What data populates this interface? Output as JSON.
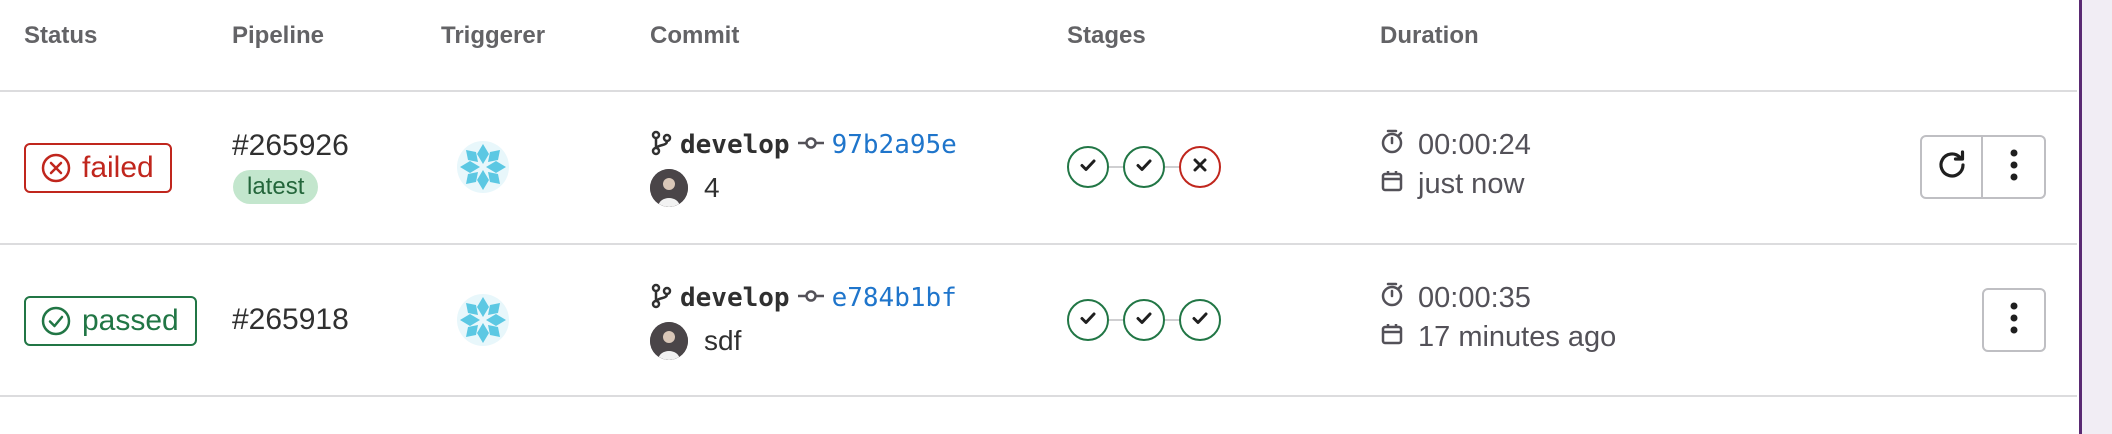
{
  "headers": {
    "status": "Status",
    "pipeline": "Pipeline",
    "triggerer": "Triggerer",
    "commit": "Commit",
    "stages": "Stages",
    "duration": "Duration"
  },
  "pipelines": [
    {
      "status": "failed",
      "id": "#265926",
      "tag": "latest",
      "branch": "develop",
      "sha": "97b2a95e",
      "message": "4",
      "stages": [
        "success",
        "success",
        "failed"
      ],
      "duration": "00:00:24",
      "finished": "just now",
      "actions": [
        "retry-icon",
        "kebab-icon"
      ]
    },
    {
      "status": "passed",
      "id": "#265918",
      "branch": "develop",
      "sha": "e784b1bf",
      "message": "sdf",
      "stages": [
        "success",
        "success",
        "success"
      ],
      "duration": "00:00:35",
      "finished": "17 minutes ago",
      "actions": [
        "kebab-icon"
      ]
    }
  ],
  "colors": {
    "failed": "#c0261d",
    "passed": "#217645",
    "link": "#1f75cb",
    "badge_bg": "#c3e6cd"
  }
}
